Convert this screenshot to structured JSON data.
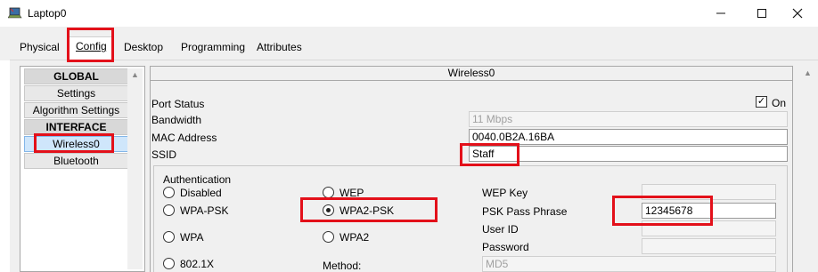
{
  "window": {
    "title": "Laptop0",
    "icon": "laptop-icon"
  },
  "tabs": [
    {
      "label": "Physical",
      "active": false
    },
    {
      "label": "Config",
      "active": true
    },
    {
      "label": "Desktop",
      "active": false
    },
    {
      "label": "Programming",
      "active": false
    },
    {
      "label": "Attributes",
      "active": false
    }
  ],
  "sidebar": {
    "items": [
      {
        "label": "GLOBAL",
        "type": "header"
      },
      {
        "label": "Settings",
        "type": "item"
      },
      {
        "label": "Algorithm Settings",
        "type": "item"
      },
      {
        "label": "INTERFACE",
        "type": "header"
      },
      {
        "label": "Wireless0",
        "type": "item",
        "selected": true
      },
      {
        "label": "Bluetooth",
        "type": "item"
      }
    ]
  },
  "panel": {
    "title": "Wireless0",
    "port_status": {
      "label": "Port Status",
      "on_label": "On",
      "checked": true
    },
    "bandwidth": {
      "label": "Bandwidth",
      "value": "11 Mbps"
    },
    "mac": {
      "label": "MAC Address",
      "value": "0040.0B2A.16BA"
    },
    "ssid": {
      "label": "SSID",
      "value": "Staff"
    },
    "auth": {
      "label": "Authentication",
      "options": [
        {
          "label": "Disabled",
          "checked": false
        },
        {
          "label": "WEP",
          "checked": false
        },
        {
          "label": "WPA-PSK",
          "checked": false
        },
        {
          "label": "WPA2-PSK",
          "checked": true
        },
        {
          "label": "WPA",
          "checked": false
        },
        {
          "label": "WPA2",
          "checked": false
        },
        {
          "label": "802.1X",
          "checked": false
        }
      ],
      "wep_key": {
        "label": "WEP Key",
        "value": ""
      },
      "psk": {
        "label": "PSK Pass Phrase",
        "value": "12345678"
      },
      "user_id": {
        "label": "User ID",
        "value": ""
      },
      "password": {
        "label": "Password",
        "value": ""
      },
      "method": {
        "label": "Method:",
        "value": "MD5"
      }
    }
  },
  "highlight_color": "#e3101a"
}
